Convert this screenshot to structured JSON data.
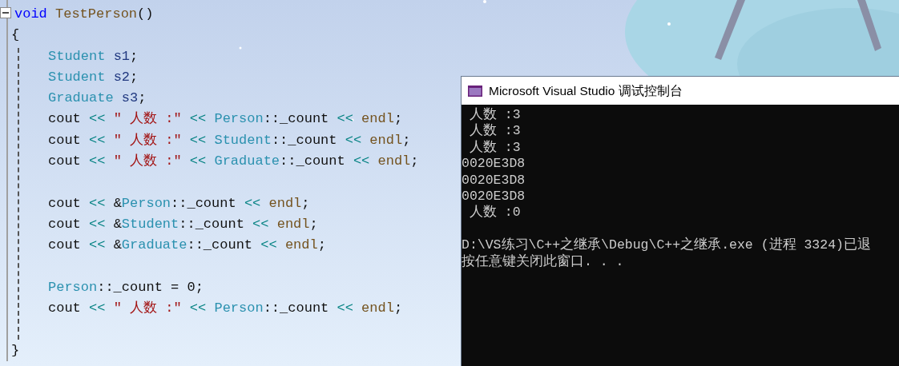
{
  "editor": {
    "lines": [
      {
        "kind": "code",
        "collapsible": true,
        "tokens": [
          {
            "text": "void ",
            "kind": "keyword"
          },
          {
            "text": "TestPerson",
            "kind": "function"
          },
          {
            "text": "()",
            "kind": "plain"
          }
        ]
      },
      {
        "kind": "code",
        "tokens": [
          {
            "text": "{",
            "kind": "plain"
          }
        ]
      },
      {
        "kind": "code",
        "tokens": [
          {
            "text": "Student ",
            "kind": "type"
          },
          {
            "text": "s1",
            "kind": "variable"
          },
          {
            "text": ";",
            "kind": "plain"
          }
        ]
      },
      {
        "kind": "code",
        "tokens": [
          {
            "text": "Student ",
            "kind": "type"
          },
          {
            "text": "s2",
            "kind": "variable"
          },
          {
            "text": ";",
            "kind": "plain"
          }
        ]
      },
      {
        "kind": "code",
        "tokens": [
          {
            "text": "Graduate ",
            "kind": "type"
          },
          {
            "text": "s3",
            "kind": "variable"
          },
          {
            "text": ";",
            "kind": "plain"
          }
        ]
      },
      {
        "kind": "code",
        "tokens": [
          {
            "text": "cout ",
            "kind": "plain"
          },
          {
            "text": "<< ",
            "kind": "operator"
          },
          {
            "text": "″ 人数 :″ ",
            "kind": "string"
          },
          {
            "text": "<< ",
            "kind": "operator"
          },
          {
            "text": "Person",
            "kind": "type"
          },
          {
            "text": "::_count ",
            "kind": "plain"
          },
          {
            "text": "<< ",
            "kind": "operator"
          },
          {
            "text": "endl",
            "kind": "function"
          },
          {
            "text": ";",
            "kind": "plain"
          }
        ]
      },
      {
        "kind": "code",
        "tokens": [
          {
            "text": "cout ",
            "kind": "plain"
          },
          {
            "text": "<< ",
            "kind": "operator"
          },
          {
            "text": "″ 人数 :″ ",
            "kind": "string"
          },
          {
            "text": "<< ",
            "kind": "operator"
          },
          {
            "text": "Student",
            "kind": "type"
          },
          {
            "text": "::_count ",
            "kind": "plain"
          },
          {
            "text": "<< ",
            "kind": "operator"
          },
          {
            "text": "endl",
            "kind": "function"
          },
          {
            "text": ";",
            "kind": "plain"
          }
        ]
      },
      {
        "kind": "code",
        "tokens": [
          {
            "text": "cout ",
            "kind": "plain"
          },
          {
            "text": "<< ",
            "kind": "operator"
          },
          {
            "text": "″ 人数 :″ ",
            "kind": "string"
          },
          {
            "text": "<< ",
            "kind": "operator"
          },
          {
            "text": "Graduate",
            "kind": "type"
          },
          {
            "text": "::_count ",
            "kind": "plain"
          },
          {
            "text": "<< ",
            "kind": "operator"
          },
          {
            "text": "endl",
            "kind": "function"
          },
          {
            "text": ";",
            "kind": "plain"
          }
        ]
      },
      {
        "kind": "blank"
      },
      {
        "kind": "code",
        "tokens": [
          {
            "text": "cout ",
            "kind": "plain"
          },
          {
            "text": "<< ",
            "kind": "operator"
          },
          {
            "text": "&",
            "kind": "plain"
          },
          {
            "text": "Person",
            "kind": "type"
          },
          {
            "text": "::_count ",
            "kind": "plain"
          },
          {
            "text": "<< ",
            "kind": "operator"
          },
          {
            "text": "endl",
            "kind": "function"
          },
          {
            "text": ";",
            "kind": "plain"
          }
        ]
      },
      {
        "kind": "code",
        "tokens": [
          {
            "text": "cout ",
            "kind": "plain"
          },
          {
            "text": "<< ",
            "kind": "operator"
          },
          {
            "text": "&",
            "kind": "plain"
          },
          {
            "text": "Student",
            "kind": "type"
          },
          {
            "text": "::_count ",
            "kind": "plain"
          },
          {
            "text": "<< ",
            "kind": "operator"
          },
          {
            "text": "endl",
            "kind": "function"
          },
          {
            "text": ";",
            "kind": "plain"
          }
        ]
      },
      {
        "kind": "code",
        "tokens": [
          {
            "text": "cout ",
            "kind": "plain"
          },
          {
            "text": "<< ",
            "kind": "operator"
          },
          {
            "text": "&",
            "kind": "plain"
          },
          {
            "text": "Graduate",
            "kind": "type"
          },
          {
            "text": "::_count ",
            "kind": "plain"
          },
          {
            "text": "<< ",
            "kind": "operator"
          },
          {
            "text": "endl",
            "kind": "function"
          },
          {
            "text": ";",
            "kind": "plain"
          }
        ]
      },
      {
        "kind": "blank"
      },
      {
        "kind": "code",
        "tokens": [
          {
            "text": "Person",
            "kind": "type"
          },
          {
            "text": "::_count = 0;",
            "kind": "plain"
          }
        ]
      },
      {
        "kind": "code",
        "tokens": [
          {
            "text": "cout ",
            "kind": "plain"
          },
          {
            "text": "<< ",
            "kind": "operator"
          },
          {
            "text": "″ 人数 :″ ",
            "kind": "string"
          },
          {
            "text": "<< ",
            "kind": "operator"
          },
          {
            "text": "Person",
            "kind": "type"
          },
          {
            "text": "::_count ",
            "kind": "plain"
          },
          {
            "text": "<< ",
            "kind": "operator"
          },
          {
            "text": "endl",
            "kind": "function"
          },
          {
            "text": ";",
            "kind": "plain"
          }
        ]
      },
      {
        "kind": "blank"
      },
      {
        "kind": "code",
        "tokens": [
          {
            "text": "}",
            "kind": "plain"
          }
        ]
      }
    ]
  },
  "console": {
    "title": "Microsoft Visual Studio 调试控制台",
    "lines": [
      {
        "kind": "text",
        "text": " 人数 :3"
      },
      {
        "kind": "text",
        "text": " 人数 :3"
      },
      {
        "kind": "text",
        "text": " 人数 :3"
      },
      {
        "kind": "text",
        "text": "0020E3D8"
      },
      {
        "kind": "text",
        "text": "0020E3D8"
      },
      {
        "kind": "text",
        "text": "0020E3D8"
      },
      {
        "kind": "text",
        "text": " 人数 :0"
      },
      {
        "kind": "blank"
      },
      {
        "kind": "text",
        "text": "D:\\VS练习\\C++之继承\\Debug\\C++之继承.exe (进程 3324)已退"
      },
      {
        "kind": "text",
        "text": "按任意键关闭此窗口. . ."
      }
    ]
  }
}
